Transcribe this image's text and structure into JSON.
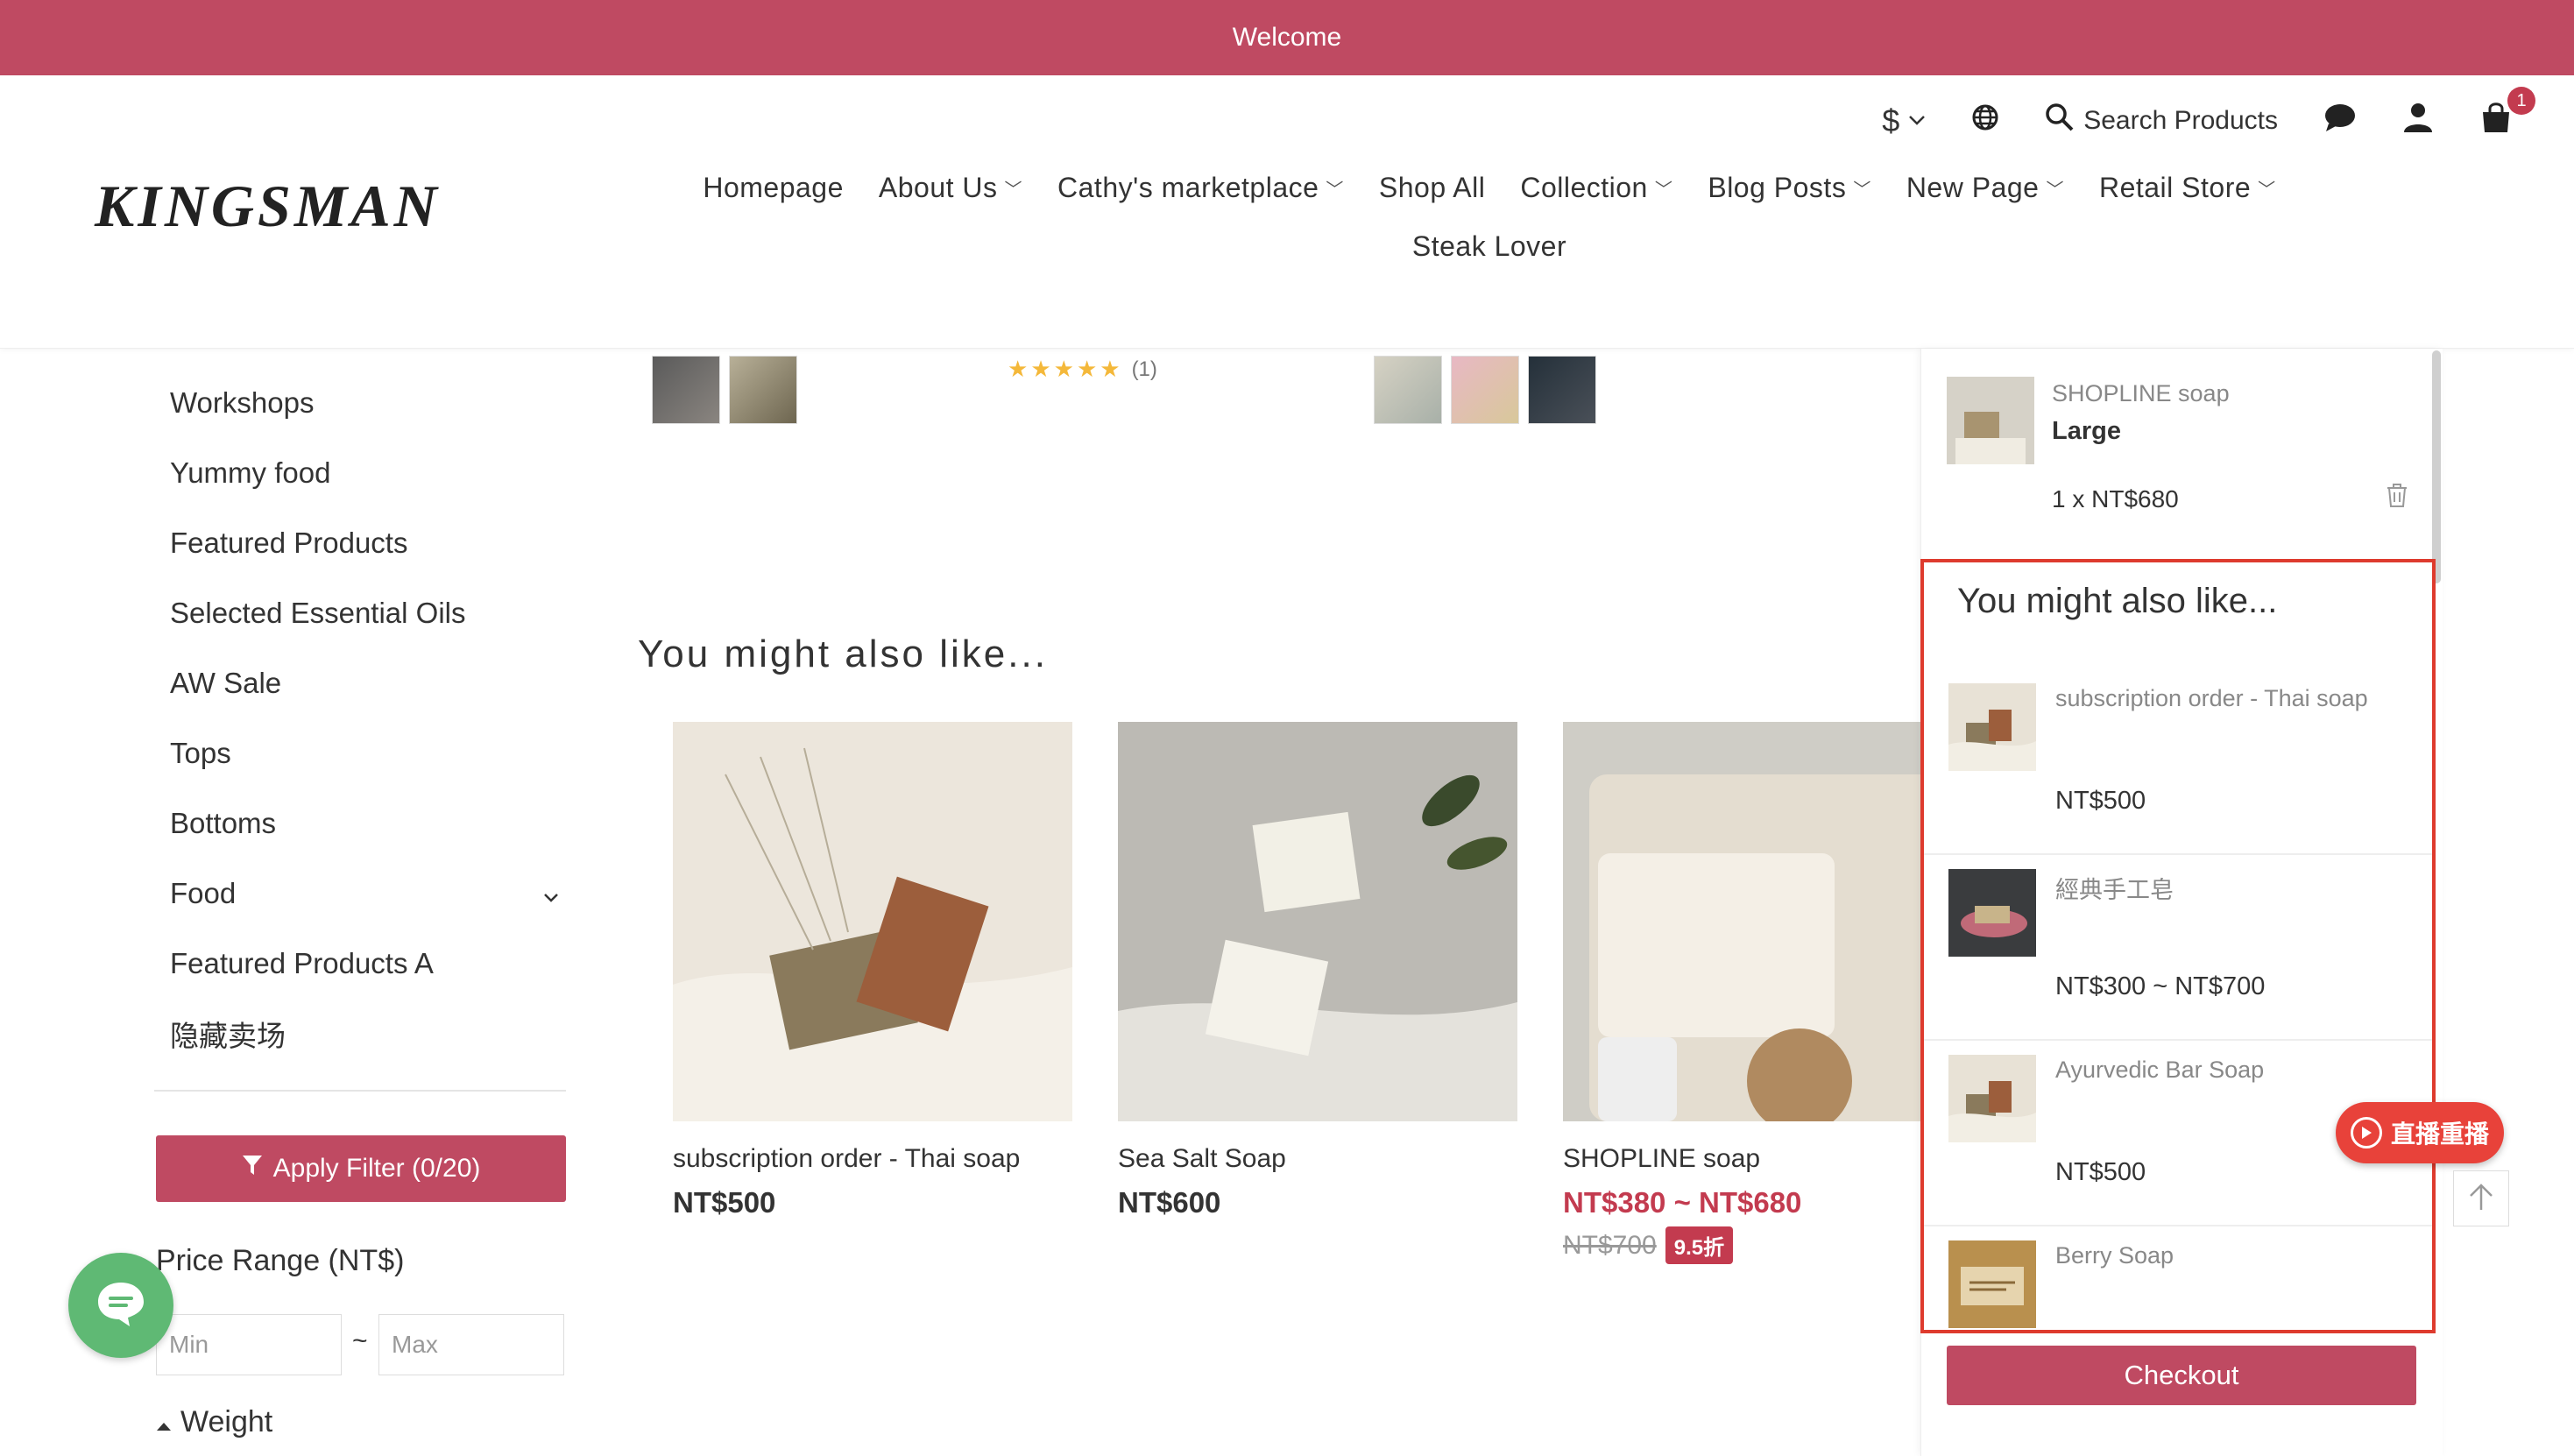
{
  "announcement": {
    "text": "Welcome"
  },
  "header": {
    "currency": "$",
    "search_label": "Search Products",
    "cart_count": "1",
    "logo": "KINGSMAN",
    "nav": [
      {
        "label": "Homepage",
        "dropdown": false
      },
      {
        "label": "About Us",
        "dropdown": true
      },
      {
        "label": "Cathy's marketplace",
        "dropdown": true
      },
      {
        "label": "Shop All",
        "dropdown": false
      },
      {
        "label": "Collection",
        "dropdown": true
      },
      {
        "label": "Blog Posts",
        "dropdown": true
      },
      {
        "label": "New Page",
        "dropdown": true
      },
      {
        "label": "Retail Store",
        "dropdown": true
      },
      {
        "label": "Steak Lover",
        "dropdown": false
      }
    ]
  },
  "sidebar": {
    "categories": [
      "Workshops",
      "Yummy food",
      "Featured Products",
      "Selected Essential Oils",
      "AW Sale",
      "Tops",
      "Bottoms",
      "Food",
      "Featured Products A",
      "隐藏卖场"
    ],
    "apply_filter_label": "Apply Filter (0/20)",
    "price_range_label": "Price Range (NT$)",
    "min_placeholder": "Min",
    "max_placeholder": "Max",
    "tilde": "~",
    "weight_label": "Weight"
  },
  "main": {
    "rating_count": "(1)",
    "section_title": "You might also like...",
    "products": [
      {
        "name": "subscription order - Thai soap",
        "price": "NT$500"
      },
      {
        "name": "Sea Salt Soap",
        "price": "NT$600"
      },
      {
        "name": "SHOPLINE soap",
        "price": "NT$380 ~ NT$680",
        "original": "NT$700",
        "discount": "9.5折"
      }
    ]
  },
  "cart": {
    "item": {
      "name": "SHOPLINE soap",
      "variant": "Large",
      "qty_price": "1 x  NT$680"
    },
    "yml_title": "You might also like...",
    "recommendations": [
      {
        "name": "subscription order - Thai soap",
        "price": "NT$500"
      },
      {
        "name": "經典手工皂",
        "price": "NT$300 ~ NT$700"
      },
      {
        "name": "Ayurvedic Bar Soap",
        "price": "NT$500"
      },
      {
        "name": "Berry Soap",
        "price": ""
      }
    ],
    "checkout_label": "Checkout"
  },
  "floating": {
    "live_label": "直播重播"
  },
  "colors": {
    "brand": "#bf4a62",
    "highlight": "#de3b2e",
    "sale": "#c33b4f",
    "chat": "#5fb974"
  }
}
